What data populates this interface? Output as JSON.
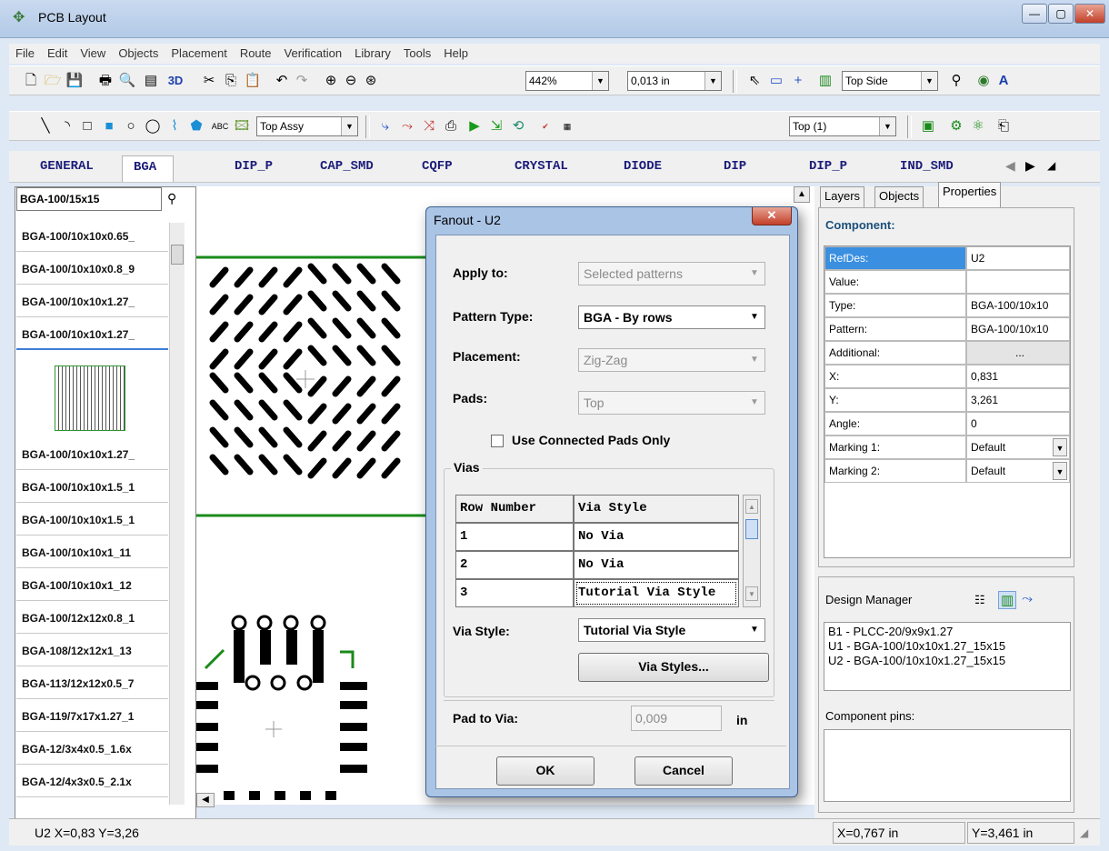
{
  "window": {
    "title": "PCB Layout",
    "min": "—",
    "max": "▢",
    "close": "✕"
  },
  "menu": [
    "File",
    "Edit",
    "View",
    "Objects",
    "Placement",
    "Route",
    "Verification",
    "Library",
    "Tools",
    "Help"
  ],
  "toolbar1": {
    "label_3d": "3D",
    "zoom": "442%",
    "grid": "0,013 in",
    "side": "Top Side"
  },
  "toolbar2": {
    "layer_set": "Top Assy",
    "text_tool": "ABC",
    "route_layer": "Top (1)"
  },
  "library_tabs": [
    "GENERAL",
    "BGA",
    "DIP_P",
    "CAP_SMD",
    "CQFP",
    "CRYSTAL",
    "DIODE",
    "DIP",
    "DIP_P",
    "IND_SMD"
  ],
  "library": {
    "search_value": "BGA-100/15x15",
    "items_top": [
      "BGA-100/10x10x0.65_",
      "BGA-100/10x10x0.8_9",
      "BGA-100/10x10x1.27_",
      "BGA-100/10x10x1.27_"
    ],
    "items_bottom": [
      "BGA-100/10x10x1.27_",
      "BGA-100/10x10x1.5_1",
      "BGA-100/10x10x1.5_1",
      "BGA-100/10x10x1_11",
      "BGA-100/10x10x1_12",
      "BGA-100/12x12x0.8_1",
      "BGA-108/12x12x1_13",
      "BGA-113/12x12x0.5_7",
      "BGA-119/7x17x1.27_1",
      "BGA-12/3x4x0.5_1.6x",
      "BGA-12/4x3x0.5_2.1x"
    ]
  },
  "right_tabs": [
    "Layers",
    "Objects",
    "Properties"
  ],
  "properties": {
    "header": "Component:",
    "rows": [
      {
        "name": "RefDes:",
        "value": "U2"
      },
      {
        "name": "Value:",
        "value": ""
      },
      {
        "name": "Type:",
        "value": "BGA-100/10x10"
      },
      {
        "name": "Pattern:",
        "value": "BGA-100/10x10"
      },
      {
        "name": "Additional:",
        "value": "..."
      },
      {
        "name": "X:",
        "value": "0,831"
      },
      {
        "name": "Y:",
        "value": "3,261"
      },
      {
        "name": "Angle:",
        "value": "0"
      },
      {
        "name": "Marking 1:",
        "value": "Default"
      },
      {
        "name": "Marking 2:",
        "value": "Default"
      }
    ]
  },
  "design_manager": {
    "title": "Design Manager",
    "items": [
      "B1 - PLCC-20/9x9x1.27",
      "U1 - BGA-100/10x10x1.27_15x15",
      "U2 - BGA-100/10x10x1.27_15x15"
    ],
    "pins_label": "Component pins:"
  },
  "status": {
    "left": "U2  X=0,83  Y=3,26",
    "x": "X=0,767 in",
    "y": "Y=3,461 in"
  },
  "dialog": {
    "title": "Fanout - U2",
    "apply_to_label": "Apply to:",
    "apply_to_value": "Selected patterns",
    "pattern_type_label": "Pattern Type:",
    "pattern_type_value": "BGA - By rows",
    "placement_label": "Placement:",
    "placement_value": "Zig-Zag",
    "pads_label": "Pads:",
    "pads_value": "Top",
    "use_connected_label": "Use Connected Pads Only",
    "vias_group": "Vias",
    "grid_headers": [
      "Row Number",
      "Via Style"
    ],
    "grid_rows": [
      {
        "row": "1",
        "style": "No Via"
      },
      {
        "row": "2",
        "style": "No Via"
      },
      {
        "row": "3",
        "style": "Tutorial Via Style"
      }
    ],
    "via_style_label": "Via Style:",
    "via_style_value": "Tutorial Via Style",
    "via_styles_button": "Via Styles...",
    "pad_to_via_label": "Pad to Via:",
    "pad_to_via_value": "0,009",
    "pad_to_via_unit": "in",
    "ok": "OK",
    "cancel": "Cancel"
  }
}
